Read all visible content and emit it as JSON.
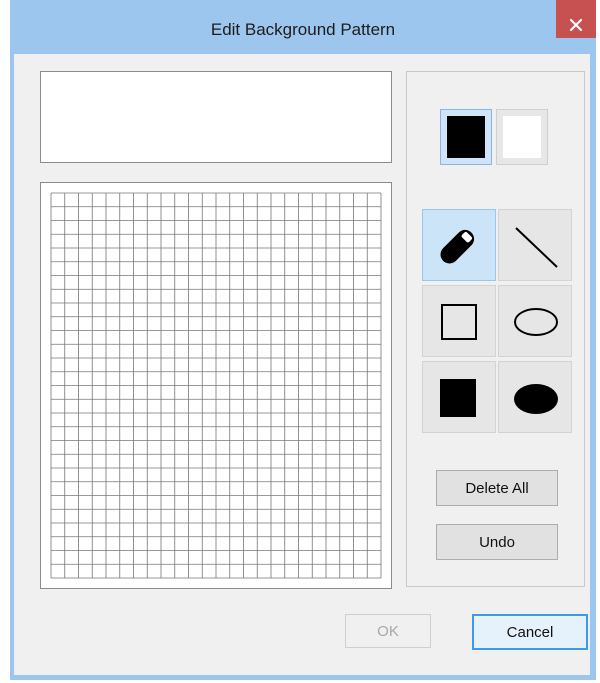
{
  "window": {
    "title": "Edit Background Pattern",
    "close_glyph": "×",
    "colors": {
      "frame": "#9dc6ee",
      "close_button": "#c75050",
      "selected_tool": "#cce4f7",
      "focus_border": "#3c9ae6"
    }
  },
  "colors": {
    "foreground_swatch": "#000000",
    "background_swatch": "#ffffff"
  },
  "tools": [
    {
      "name": "pen",
      "icon": "pen-icon",
      "selected": true
    },
    {
      "name": "line",
      "icon": "line-icon",
      "selected": false
    },
    {
      "name": "rectangle",
      "icon": "rectangle-outline-icon",
      "selected": false
    },
    {
      "name": "ellipse",
      "icon": "ellipse-outline-icon",
      "selected": false
    },
    {
      "name": "filled-rectangle",
      "icon": "rectangle-filled-icon",
      "selected": false
    },
    {
      "name": "filled-ellipse",
      "icon": "ellipse-filled-icon",
      "selected": false
    }
  ],
  "buttons": {
    "delete_all": "Delete All",
    "undo": "Undo",
    "ok": "OK",
    "cancel": "Cancel"
  },
  "grid": {
    "columns": 24,
    "rows": 28
  }
}
